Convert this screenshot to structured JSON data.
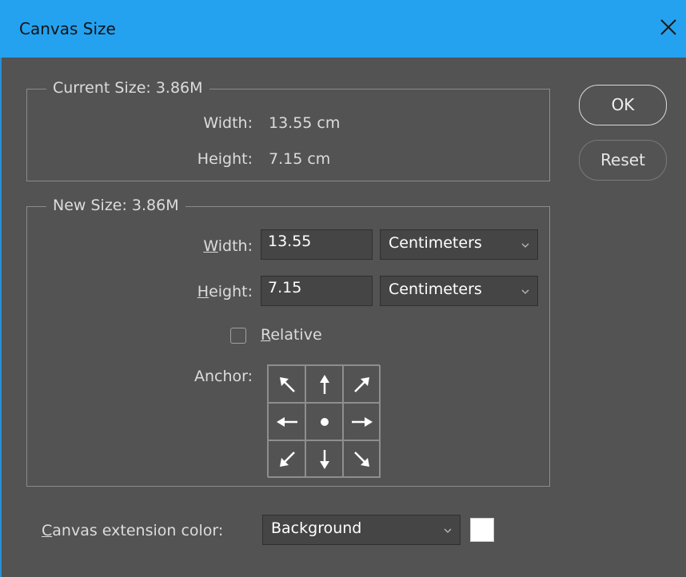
{
  "window": {
    "title": "Canvas Size",
    "close_icon": "close-icon"
  },
  "current_size": {
    "legend": "Current Size: 3.86M",
    "width_label": "Width:",
    "width_value": "13.55 cm",
    "height_label": "Height:",
    "height_value": "7.15 cm"
  },
  "new_size": {
    "legend": "New Size: 3.86M",
    "width_label": {
      "mnemonic": "W",
      "rest": "idth:"
    },
    "width_value": "13.55",
    "width_unit": "Centimeters",
    "height_label": {
      "mnemonic": "H",
      "rest": "eight:"
    },
    "height_value": "7.15",
    "height_unit": "Centimeters",
    "relative_label": {
      "mnemonic": "R",
      "rest": "elative"
    },
    "relative_checked": false,
    "anchor_label": "Anchor:",
    "anchor_icons": [
      "arrow-nw-icon",
      "arrow-n-icon",
      "arrow-ne-icon",
      "arrow-w-icon",
      "center-dot-icon",
      "arrow-e-icon",
      "arrow-sw-icon",
      "arrow-s-icon",
      "arrow-se-icon"
    ]
  },
  "buttons": {
    "ok": "OK",
    "reset": "Reset"
  },
  "extension": {
    "label": {
      "mnemonic": "C",
      "rest": "anvas extension color:"
    },
    "value": "Background",
    "swatch_color": "#ffffff"
  },
  "colors": {
    "titlebar": "#24a2f0",
    "background": "#535353"
  }
}
